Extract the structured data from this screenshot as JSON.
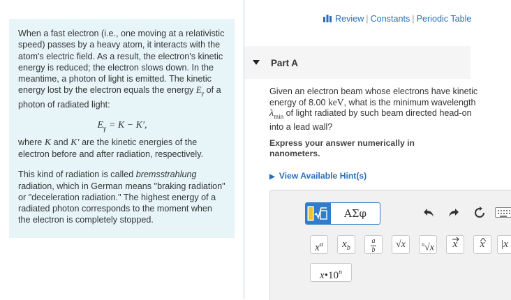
{
  "info": {
    "p1": "When a fast electron (i.e., one moving at a relativistic speed) passes by a heavy atom, it interacts with the atom's electric field. As a result, the electron's kinetic energy is reduced; the electron slows down. In the meantime, a photon of light is emitted. The kinetic energy lost by the electron equals the energy",
    "p1_sym": "E",
    "p1_sub": "γ",
    "p1_end": "of a photon of radiated light:",
    "eq_lhs": "E",
    "eq_sub": "γ",
    "eq_rhs": "= K − K′,",
    "p2_a": "where",
    "p2_k": "K",
    "p2_and": "and",
    "p2_kp": "K′",
    "p2_b": "are the kinetic energies of the electron before and after radiation, respectively.",
    "p3_a": "This kind of radiation is called",
    "p3_term": "bremsstrahlung",
    "p3_b": "radiation, which in German means \"braking radiation\" or \"deceleration radiation.\" The highest energy of a radiated photon corresponds to the moment when the electron is completely stopped."
  },
  "toplinks": {
    "review": "Review",
    "constants": "Constants",
    "periodic": "Periodic Table",
    "sep": "|"
  },
  "part": {
    "title": "Part A"
  },
  "question": {
    "a": "Given an electron beam whose electrons have kinetic energy of 8.00",
    "unit": "keV",
    "b": ", what is the minimum wavelength",
    "lam": "λ",
    "lam_sub": "min",
    "c": "of light radiated by such beam directed head-on into a lead wall?"
  },
  "instruction": "Express your answer numerically in nanometers.",
  "hint": "View Available Hint(s)",
  "toolbar": {
    "greek": "ΑΣφ",
    "templates": [
      {
        "base": "x",
        "sup": "a"
      },
      {
        "base": "x",
        "sub": "b"
      },
      {
        "num": "a",
        "den": "b"
      },
      {
        "rad": "√x"
      },
      {
        "nrad": "n",
        "rad": "√x"
      },
      {
        "vec": "x"
      },
      {
        "hat": "x"
      },
      {
        "abs": "|x"
      }
    ],
    "sci_base": "x",
    "sci_dot": "•10",
    "sci_exp": "n"
  },
  "colors": {
    "accent": "#2f7dcc",
    "link": "#2a6fb6",
    "info_bg": "#e7f5f9"
  }
}
